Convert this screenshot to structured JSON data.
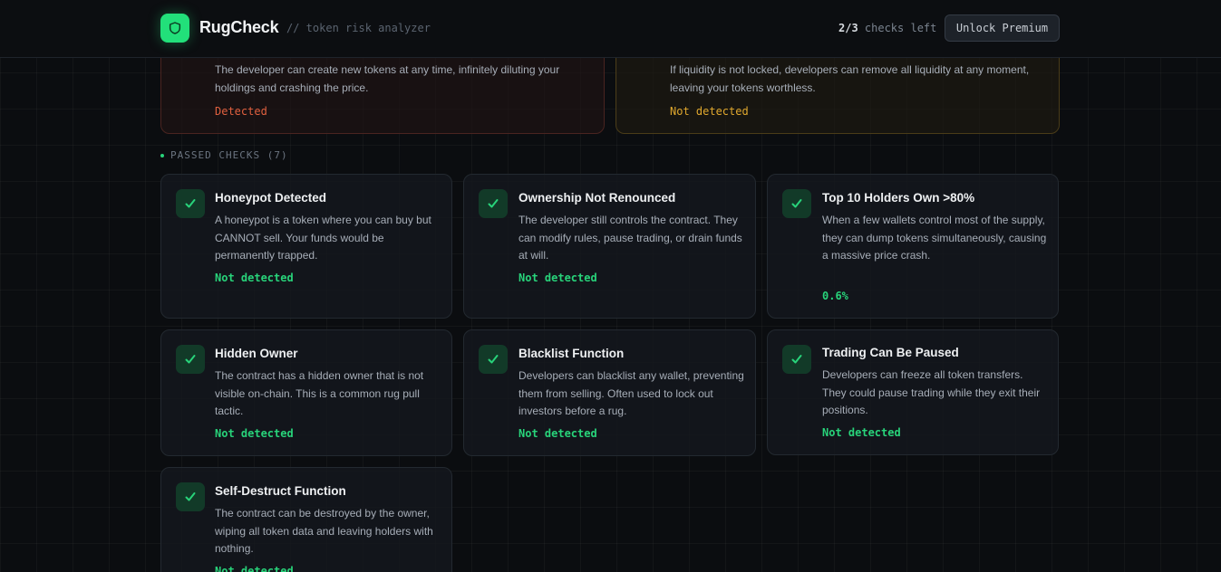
{
  "header": {
    "app_name": "RugCheck",
    "tagline": "// token risk analyzer",
    "checks_count": "2/3",
    "checks_suffix": " checks left",
    "unlock_label": "Unlock Premium"
  },
  "top_cards": [
    {
      "description": "The developer can create new tokens at any time, infinitely diluting your holdings and crashing the price.",
      "status": "Detected",
      "status_color": "#e0603f"
    },
    {
      "description": "If liquidity is not locked, developers can remove all liquidity at any moment, leaving your tokens worthless.",
      "status": "Not detected",
      "status_color": "#e0a82e"
    }
  ],
  "passed_section": {
    "label": "PASSED CHECKS (7)"
  },
  "passed_checks": [
    {
      "title": "Honeypot Detected",
      "description": "A honeypot is a token where you can buy but CANNOT sell. Your funds would be permanently trapped.",
      "status": "Not detected"
    },
    {
      "title": "Ownership Not Renounced",
      "description": "The developer still controls the contract. They can modify rules, pause trading, or drain funds at will.",
      "status": "Not detected"
    },
    {
      "title": "Top 10 Holders Own >80%",
      "description": "When a few wallets control most of the supply, they can dump tokens simultaneously, causing a massive price crash.",
      "status": "0.6%"
    },
    {
      "title": "Hidden Owner",
      "description": "The contract has a hidden owner that is not visible on-chain. This is a common rug pull tactic.",
      "status": "Not detected"
    },
    {
      "title": "Blacklist Function",
      "description": "Developers can blacklist any wallet, preventing them from selling. Often used to lock out investors before a rug.",
      "status": "Not detected"
    },
    {
      "title": "Trading Can Be Paused",
      "description": "Developers can freeze all token transfers. They could pause trading while they exit their positions.",
      "status": "Not detected"
    },
    {
      "title": "Self-Destruct Function",
      "description": "The contract can be destroyed by the owner, wiping all token data and leaving holders with nothing.",
      "status": "Not detected"
    }
  ],
  "colors": {
    "accent": "#22e07a",
    "pass": "#28d37a",
    "danger": "#e0603f",
    "warning": "#e0a82e"
  }
}
